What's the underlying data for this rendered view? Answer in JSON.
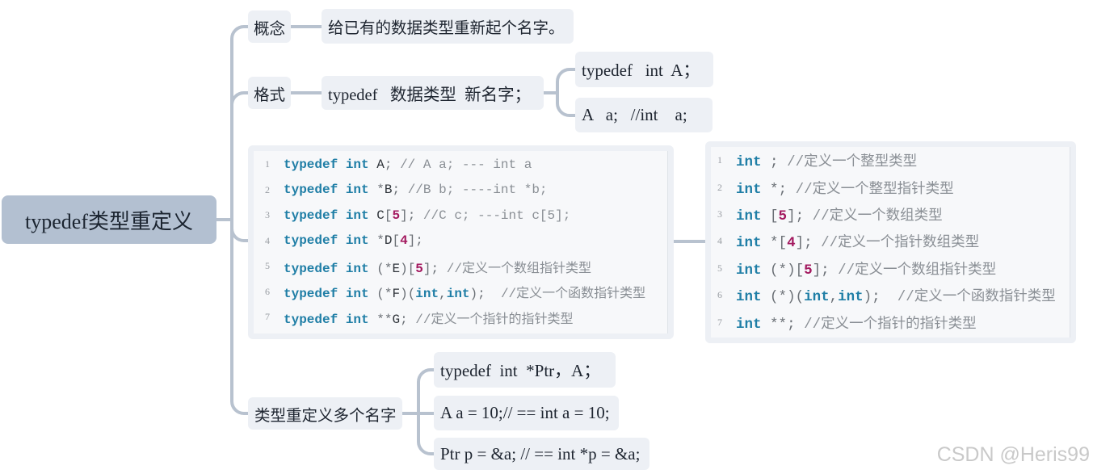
{
  "colors": {
    "root_bg": "#b3c0d1",
    "node_bg": "#edf0f5",
    "connector": "#b8c2cf",
    "code_keyword": "#1f7ea6",
    "code_number": "#a3195f",
    "code_comment": "#8a8f95",
    "watermark": "#c9c9c9"
  },
  "root": {
    "label": "typedef类型重定义"
  },
  "concept": {
    "label": "概念",
    "definition": "给已有的数据类型重新起个名字。"
  },
  "format": {
    "label": "格式",
    "syntax": "typedef   数据类型  新名字；",
    "examples": [
      "typedef   int  A；",
      "A   a;   //int    a;"
    ]
  },
  "code_left": {
    "lines": [
      {
        "num": "1",
        "code": "typedef int A; // A a; --- int a"
      },
      {
        "num": "2",
        "code": "typedef int *B; //B b; ----int *b;"
      },
      {
        "num": "3",
        "code": "typedef int C[5]; //C c; ---int c[5];"
      },
      {
        "num": "4",
        "code": "typedef int *D[4];"
      },
      {
        "num": "5",
        "code": "typedef int (*E)[5]; //定义一个数组指针类型"
      },
      {
        "num": "6",
        "code": "typedef int (*F)(int,int);  //定义一个函数指针类型"
      },
      {
        "num": "7",
        "code": "typedef int **G; //定义一个指针的指针类型"
      }
    ]
  },
  "code_right": {
    "lines": [
      {
        "num": "1",
        "code": "int ; //定义一个整型类型"
      },
      {
        "num": "2",
        "code": "int *; //定义一个整型指针类型"
      },
      {
        "num": "3",
        "code": "int [5]; //定义一个数组类型"
      },
      {
        "num": "4",
        "code": "int *[4]; //定义一个指针数组类型"
      },
      {
        "num": "5",
        "code": "int (*)[5]; //定义一个数组指针类型"
      },
      {
        "num": "6",
        "code": "int (*)(int,int);  //定义一个函数指针类型"
      },
      {
        "num": "7",
        "code": "int **; //定义一个指针的指针类型"
      }
    ]
  },
  "multi_names": {
    "label": "类型重定义多个名字",
    "examples": [
      "typedef  int  *Ptr，A；",
      "A a = 10;// == int a = 10;",
      "Ptr p = &a; // == int *p = &a;"
    ]
  },
  "watermark": "CSDN @Heris99"
}
